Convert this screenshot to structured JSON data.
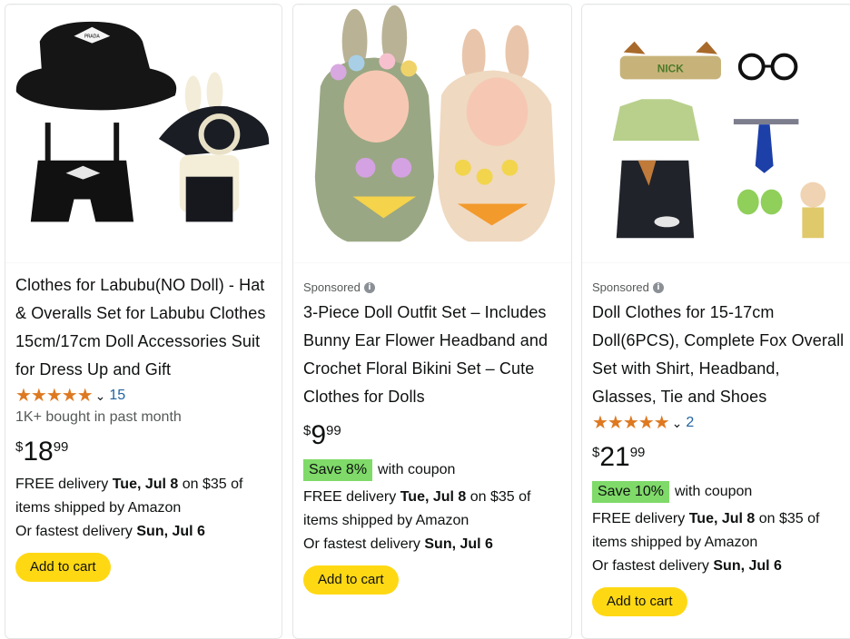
{
  "products": [
    {
      "sponsored": "",
      "title": "Clothes for Labubu(NO Doll) - Hat & Overalls Set for Labubu Clothes 15cm/17cm Doll Accessories Suit for Dress Up and Gift",
      "stars": "★★★★★",
      "rating_value": 5,
      "review_count": "15",
      "bought": "1K+ bought in past month",
      "price_symbol": "$",
      "price_whole": "18",
      "price_fraction": "99",
      "coupon_badge": "",
      "coupon_text": "",
      "delivery_free_prefix": "FREE delivery ",
      "delivery_free_date": "Tue, Jul 8",
      "delivery_free_suffix": " on $35 of items shipped by Amazon",
      "delivery_fast_prefix": "Or fastest delivery ",
      "delivery_fast_date": "Sun, Jul 6",
      "cart_label": "Add to cart",
      "image_label": "PRADA"
    },
    {
      "sponsored": "Sponsored",
      "title": "3-Piece Doll Outfit Set – Includes Bunny Ear Flower Headband and Crochet Floral Bikini Set – Cute Clothes for Dolls",
      "stars": "",
      "rating_value": null,
      "review_count": "",
      "bought": "",
      "price_symbol": "$",
      "price_whole": "9",
      "price_fraction": "99",
      "coupon_badge": "Save 8%",
      "coupon_text": "with coupon",
      "delivery_free_prefix": "FREE delivery ",
      "delivery_free_date": "Tue, Jul 8",
      "delivery_free_suffix": " on $35 of items shipped by Amazon",
      "delivery_fast_prefix": "Or fastest delivery ",
      "delivery_fast_date": "Sun, Jul 6",
      "cart_label": "Add to cart",
      "image_label": ""
    },
    {
      "sponsored": "Sponsored",
      "title": "Doll Clothes for 15-17cm Doll(6PCS), Complete Fox Overall Set with Shirt, Headband, Glasses, Tie and Shoes",
      "stars": "★★★★★",
      "rating_value": 5,
      "review_count": "2",
      "bought": "",
      "price_symbol": "$",
      "price_whole": "21",
      "price_fraction": "99",
      "coupon_badge": "Save 10%",
      "coupon_text": "with coupon",
      "delivery_free_prefix": "FREE delivery ",
      "delivery_free_date": "Tue, Jul 8",
      "delivery_free_suffix": " on $35 of items shipped by Amazon",
      "delivery_fast_prefix": "Or fastest delivery ",
      "delivery_fast_date": "Sun, Jul 6",
      "cart_label": "Add to cart",
      "image_label": "NICK"
    }
  ],
  "sponsored_info_icon": "i",
  "chevron": "⌄",
  "colors": {
    "star": "#de7921",
    "link": "#2162a1",
    "coupon_bg": "#7fda69",
    "cart_button": "#ffd814",
    "muted": "#565959"
  }
}
